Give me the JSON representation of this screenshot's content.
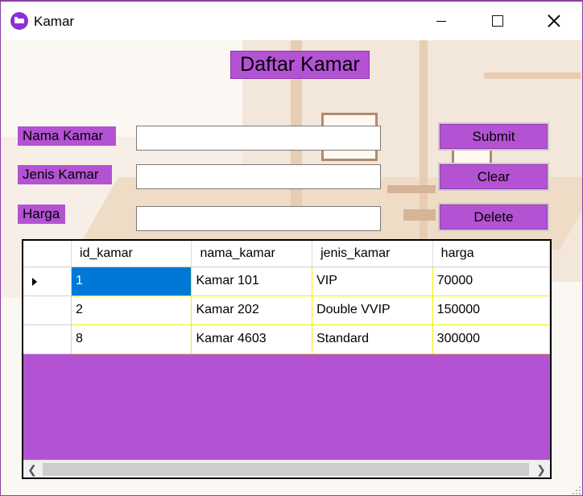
{
  "window": {
    "title": "Kamar"
  },
  "heading": "Daftar Kamar",
  "form": {
    "nama_label": "Nama Kamar",
    "jenis_label": "Jenis Kamar",
    "harga_label": "Harga",
    "nama_value": "",
    "jenis_value": "",
    "harga_value": ""
  },
  "buttons": {
    "submit": "Submit",
    "clear": "Clear",
    "delete": "Delete"
  },
  "grid": {
    "columns": [
      "id_kamar",
      "nama_kamar",
      "jenis_kamar",
      "harga"
    ],
    "rows": [
      [
        "1",
        "Kamar 101",
        "VIP",
        "70000"
      ],
      [
        "2",
        "Kamar 202",
        "Double VVIP",
        "150000"
      ],
      [
        "8",
        "Kamar 4603",
        "Standard",
        "300000"
      ]
    ]
  },
  "colors": {
    "accent": "#b452d4",
    "selection": "#0078d7",
    "grid_line": "#f0f000"
  },
  "icons": {
    "app": "bed-icon",
    "minimize": "minimize-icon",
    "maximize": "maximize-icon",
    "close": "close-icon",
    "row_indicator": "row-pointer-icon",
    "scroll_left": "scroll-left-icon",
    "scroll_right": "scroll-right-icon"
  }
}
